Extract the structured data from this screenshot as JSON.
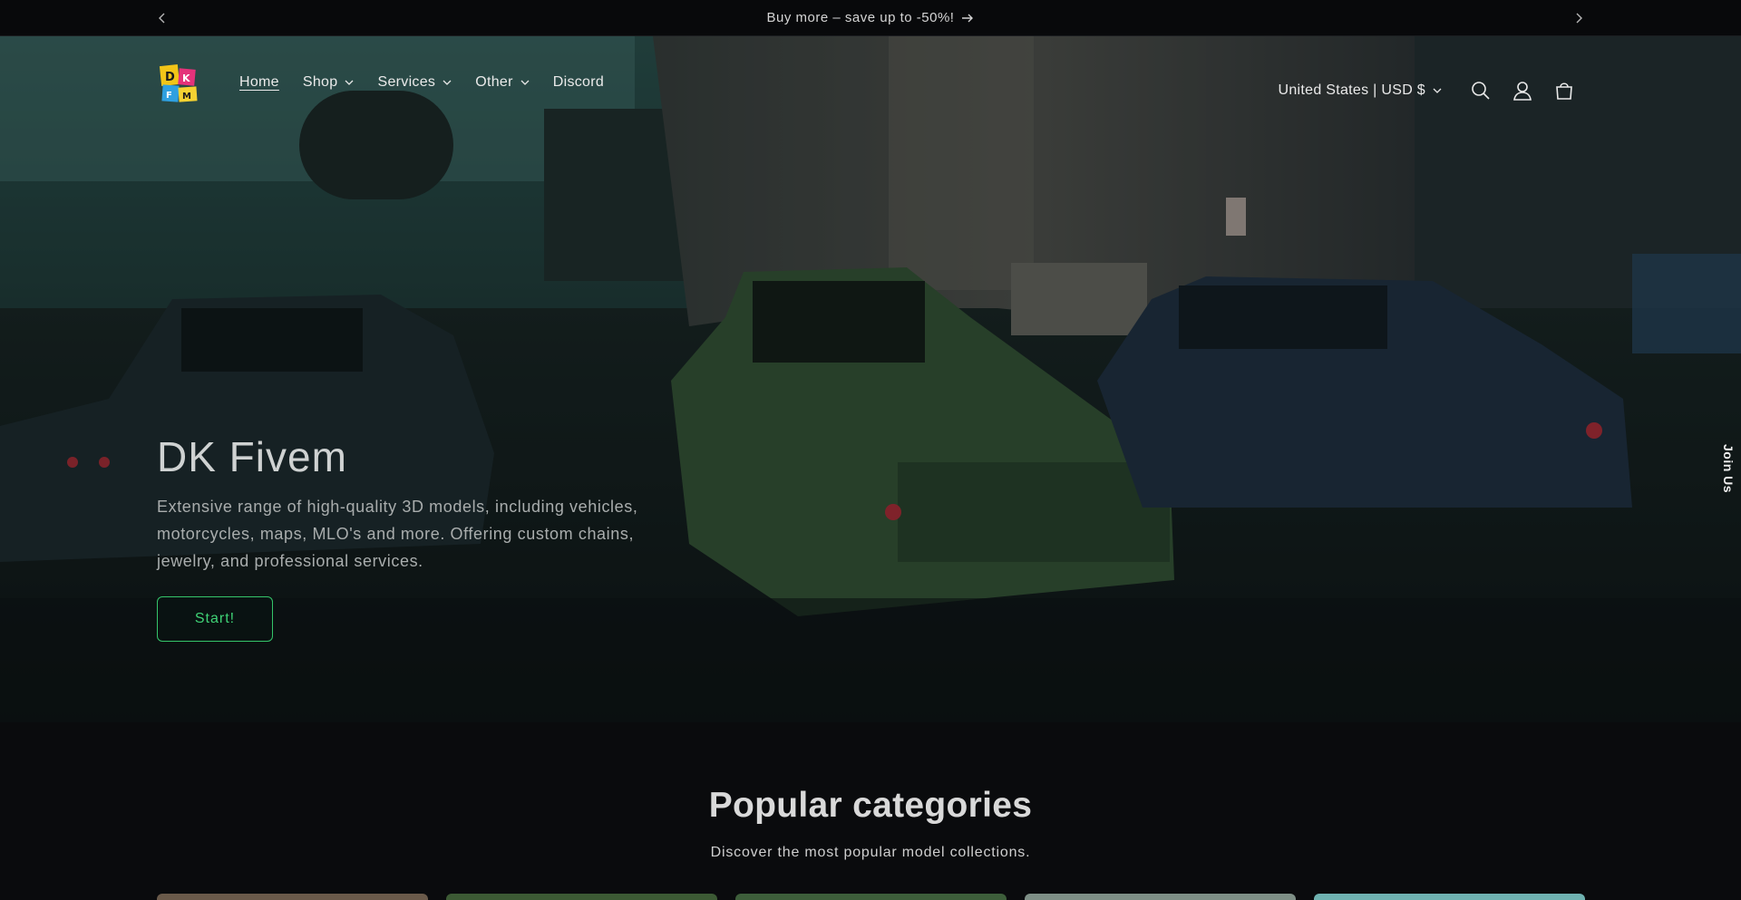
{
  "announcement": {
    "message": "Buy more – save up to -50%!",
    "prev_icon": "chevron-left-icon",
    "next_icon": "chevron-right-icon",
    "arrow_icon": "arrow-right-icon"
  },
  "header": {
    "logo_icon": "dk-fivem-logo",
    "nav": [
      {
        "label": "Home",
        "active": true,
        "dropdown": false
      },
      {
        "label": "Shop",
        "active": false,
        "dropdown": true
      },
      {
        "label": "Services",
        "active": false,
        "dropdown": true
      },
      {
        "label": "Other",
        "active": false,
        "dropdown": true
      },
      {
        "label": "Discord",
        "active": false,
        "dropdown": false
      }
    ],
    "locale": "United States | USD $",
    "icons": [
      "search-icon",
      "account-icon",
      "cart-icon"
    ]
  },
  "hero": {
    "title": "DK Fivem",
    "text": "Extensive range of high-quality 3D models, including vehicles, motorcycles, maps, MLO's and more. Offering custom chains, jewelry, and professional services.",
    "button": "Start!",
    "accent_color": "#3fd276"
  },
  "side_tab": {
    "label": "Join Us"
  },
  "categories": {
    "title": "Popular categories",
    "subtitle": "Discover the most popular model collections.",
    "card_colors": [
      "#6a5a4a",
      "#3c5a34",
      "#3d5e3a",
      "#7e8f86",
      "#6fb2b0"
    ]
  }
}
